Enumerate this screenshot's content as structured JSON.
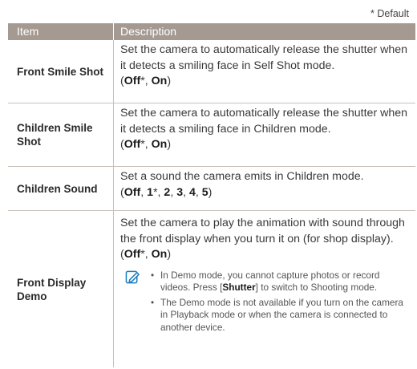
{
  "default_note": "* Default",
  "header": {
    "col1": "Item",
    "col2": "Description"
  },
  "rows": [
    {
      "item": "Front Smile Shot",
      "desc": "Set the camera to automatically release the shutter when it detects a smiling face in Self Shot mode.",
      "opts": [
        {
          "t": "(",
          "b": false
        },
        {
          "t": "Off",
          "b": true
        },
        {
          "t": "*, ",
          "b": false
        },
        {
          "t": "On",
          "b": true
        },
        {
          "t": ")",
          "b": false
        }
      ]
    },
    {
      "item": "Children Smile Shot",
      "desc": "Set the camera to automatically release the shutter when it detects a smiling face in Children mode.",
      "opts": [
        {
          "t": "(",
          "b": false
        },
        {
          "t": "Off",
          "b": true
        },
        {
          "t": "*, ",
          "b": false
        },
        {
          "t": "On",
          "b": true
        },
        {
          "t": ")",
          "b": false
        }
      ]
    },
    {
      "item": "Children Sound",
      "desc": "Set a sound the camera emits in Children mode.",
      "opts": [
        {
          "t": "(",
          "b": false
        },
        {
          "t": "Off",
          "b": true
        },
        {
          "t": ", ",
          "b": false
        },
        {
          "t": "1",
          "b": true
        },
        {
          "t": "*, ",
          "b": false
        },
        {
          "t": "2",
          "b": true
        },
        {
          "t": ", ",
          "b": false
        },
        {
          "t": "3",
          "b": true
        },
        {
          "t": ", ",
          "b": false
        },
        {
          "t": "4",
          "b": true
        },
        {
          "t": ", ",
          "b": false
        },
        {
          "t": "5",
          "b": true
        },
        {
          "t": ")",
          "b": false
        }
      ]
    },
    {
      "item": "Front Display Demo",
      "desc": "Set the camera to play the animation with sound through the front display when you turn it on (for shop display).",
      "opts": [
        {
          "t": "(",
          "b": false
        },
        {
          "t": "Off",
          "b": true
        },
        {
          "t": "*, ",
          "b": false
        },
        {
          "t": "On",
          "b": true
        },
        {
          "t": ")",
          "b": false
        }
      ]
    }
  ],
  "note": {
    "icon": "note-pencil-icon",
    "bullet1_a": "In Demo mode, you cannot capture photos or record videos. Press [",
    "bullet1_b": "Shutter",
    "bullet1_c": "] to switch to Shooting mode.",
    "bullet2": "The Demo mode is not available if you turn on the camera in Playback mode or when the camera is connected to another device."
  },
  "colors": {
    "header_bg": "#a49a92",
    "icon": "#1a7fc1",
    "rule": "#c9c0b8"
  }
}
